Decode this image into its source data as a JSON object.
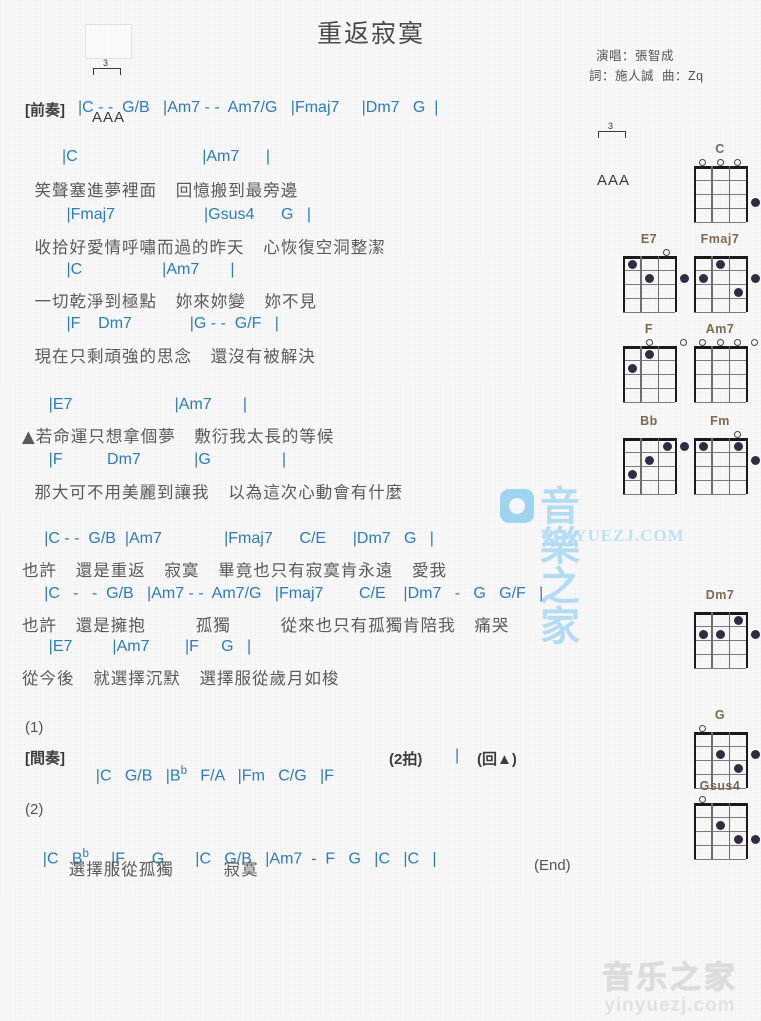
{
  "header": {
    "title": "重返寂寞",
    "singer_line": "演唱：張智成",
    "credits_line": "詞：施人誠  曲：Zq"
  },
  "strum_pattern": {
    "triplet_number": "3",
    "strokes": "AAA"
  },
  "intro": {
    "label": "[前奏]",
    "chords": "|C - -  G/B   |Am7 - -  Am7/G   |Fmaj7     |Dm7   G  |"
  },
  "verse1": [
    {
      "chords": "         |C                            |Am7      |",
      "lyrics": "  笑聲塞進夢裡面   回憶搬到最旁邊"
    },
    {
      "chords": "          |Fmaj7                    |Gsus4      G   |",
      "lyrics": "  收拾好愛情呼嘯而過的昨天   心恢復空洞整潔"
    },
    {
      "chords": "          |C                  |Am7       |",
      "lyrics": "  一切乾淨到極點   妳來妳變   妳不見"
    },
    {
      "chords": "          |F    Dm7             |G - -  G/F   |",
      "lyrics": "  現在只剩頑強的思念   還沒有被解決"
    }
  ],
  "verse2": [
    {
      "chords": "      |E7                       |Am7       |",
      "lyrics": "▲若命運只想拿個夢   敷衍我太長的等候"
    },
    {
      "chords": "      |F          Dm7            |G                |",
      "lyrics": "  那大可不用美麗到讓我   以為這次心動會有什麼"
    }
  ],
  "chorus": [
    {
      "chords": "     |C - -  G/B  |Am7              |Fmaj7      C/E      |Dm7   G   |",
      "lyrics": "也許   還是重返   寂寞   畢竟也只有寂寞肯永遠   愛我"
    },
    {
      "chords": "     |C   -   -  G/B   |Am7 - -  Am7/G   |Fmaj7        C/E    |Dm7   -   G   G/F   |",
      "lyrics": "也許   還是擁抱        孤獨        從來也只有孤獨肯陪我   痛哭"
    },
    {
      "chords": "      |E7         |Am7        |F     G   |",
      "lyrics": "從今後   就選擇沉默   選擇服從歲月如梭"
    }
  ],
  "ending1": {
    "number": "(1)",
    "label": "[間奏]",
    "chords_before": "|C   G/B   |B",
    "flat": "b",
    "chords_after": "   F/A   |Fm   C/G   |F",
    "beat_note": "(2拍)",
    "tail_bar": "|",
    "repeat_note": "(回▲)"
  },
  "ending2": {
    "number": "(2)",
    "chords_1": "|C   B",
    "flat": "b",
    "chords_2": "     |F      G       |C   G/B   |Am7  -  F   G   |C   |C   |",
    "lyrics": "       選擇服從孤獨        寂寞",
    "end_note": "(End)"
  },
  "chord_diagrams": [
    {
      "name": "C",
      "open": [
        1,
        1,
        1,
        0
      ],
      "dots": [
        {
          "string": 4,
          "fret": 3
        }
      ]
    },
    {
      "name": "E7",
      "open": [
        0,
        0,
        1,
        0
      ],
      "dots": [
        {
          "string": 1,
          "fret": 1
        },
        {
          "string": 2,
          "fret": 2
        },
        {
          "string": 4,
          "fret": 2
        }
      ]
    },
    {
      "name": "Fmaj7",
      "open": [
        0,
        0,
        0,
        0
      ],
      "dots": [
        {
          "string": 1,
          "fret": 2
        },
        {
          "string": 2,
          "fret": 1
        },
        {
          "string": 3,
          "fret": 3
        },
        {
          "string": 4,
          "fret": 2
        }
      ]
    },
    {
      "name": "F",
      "open": [
        0,
        1,
        0,
        1
      ],
      "dots": [
        {
          "string": 1,
          "fret": 2
        },
        {
          "string": 2,
          "fret": 1
        }
      ]
    },
    {
      "name": "Am7",
      "open": [
        1,
        1,
        1,
        1
      ],
      "dots": []
    },
    {
      "name": "Bb",
      "open": [
        0,
        0,
        0,
        0
      ],
      "dots": [
        {
          "string": 1,
          "fret": 3
        },
        {
          "string": 2,
          "fret": 2
        },
        {
          "string": 3,
          "fret": 1
        },
        {
          "string": 4,
          "fret": 1
        }
      ]
    },
    {
      "name": "Fm",
      "open": [
        0,
        0,
        1,
        0
      ],
      "dots": [
        {
          "string": 1,
          "fret": 1
        },
        {
          "string": 3,
          "fret": 1
        },
        {
          "string": 4,
          "fret": 2
        }
      ]
    },
    {
      "name": "Dm7",
      "open": [
        0,
        0,
        0,
        0
      ],
      "dots": [
        {
          "string": 1,
          "fret": 2
        },
        {
          "string": 2,
          "fret": 2
        },
        {
          "string": 3,
          "fret": 1
        },
        {
          "string": 4,
          "fret": 2
        }
      ]
    },
    {
      "name": "G",
      "open": [
        1,
        0,
        0,
        0
      ],
      "dots": [
        {
          "string": 2,
          "fret": 2
        },
        {
          "string": 3,
          "fret": 3
        },
        {
          "string": 4,
          "fret": 2
        }
      ]
    },
    {
      "name": "Gsus4",
      "open": [
        1,
        0,
        0,
        0
      ],
      "dots": [
        {
          "string": 2,
          "fret": 2
        },
        {
          "string": 3,
          "fret": 3
        },
        {
          "string": 4,
          "fret": 3
        }
      ]
    }
  ],
  "watermark": {
    "mid_text": "音樂之家",
    "mid_url": "YINYUEZJ.COM",
    "foot_text": "音乐之家",
    "foot_url": "yinyuezj.com"
  },
  "colors": {
    "chord": "#2b7bc4",
    "lyric": "#5a5a5a",
    "barline": "#b8860b",
    "chord_name": "#7b6a4e",
    "watermark_blue": "#79c7f0",
    "background": "#f7f7f7"
  }
}
